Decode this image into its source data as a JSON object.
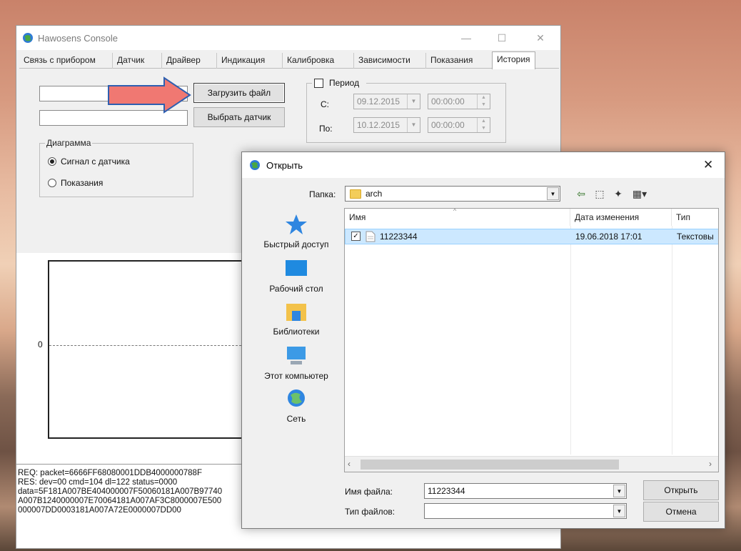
{
  "main_window": {
    "title": "Hawosens Console",
    "tabs": [
      {
        "label": "Связь с прибором"
      },
      {
        "label": "Датчик"
      },
      {
        "label": "Драйвер"
      },
      {
        "label": "Индикация"
      },
      {
        "label": "Калибровка"
      },
      {
        "label": "Зависимости"
      },
      {
        "label": "Показания"
      },
      {
        "label": "История",
        "active": true
      }
    ],
    "load_file_button": "Загрузить файл",
    "select_sensor_button": "Выбрать датчик",
    "period": {
      "label": "Период",
      "checked": false,
      "from_label": "С:",
      "to_label": "По:",
      "from_date": "09.12.2015",
      "from_time": "00:00:00",
      "to_date": "10.12.2015",
      "to_time": "00:00:00"
    },
    "diagram": {
      "label": "Диаграмма",
      "options": [
        "Сигнал с датчика",
        "Показания"
      ],
      "selected": "Сигнал с датчика"
    },
    "chart": {
      "zero_label": "0"
    },
    "log_lines": [
      "REQ: packet=6666FF68080001DDB4000000788F",
      "RES: dev=00 cmd=104 dl=122 status=0000",
      "data=5F181A007BE404000007F50060181A007B97740",
      "A007B1240000007E70064181A007AF3C8000007E500",
      "000007DD0003181A007A72E0000007DD00"
    ]
  },
  "open_dialog": {
    "title": "Открыть",
    "folder_label": "Папка:",
    "folder_value": "arch",
    "places": [
      "Быстрый доступ",
      "Рабочий стол",
      "Библиотеки",
      "Этот компьютер",
      "Сеть"
    ],
    "columns": {
      "name": "Имя",
      "date": "Дата изменения",
      "type": "Тип"
    },
    "files": [
      {
        "name": "11223344",
        "date": "19.06.2018 17:01",
        "type": "Текстовы",
        "checked": true
      }
    ],
    "filename_label": "Имя файла:",
    "filename_value": "11223344",
    "filetype_label": "Тип файлов:",
    "filetype_value": "",
    "open_button": "Открыть",
    "cancel_button": "Отмена"
  },
  "colors": {
    "annotation_arrow": "#f07872",
    "selection": "#cce8ff",
    "chart_border": "#222222"
  }
}
